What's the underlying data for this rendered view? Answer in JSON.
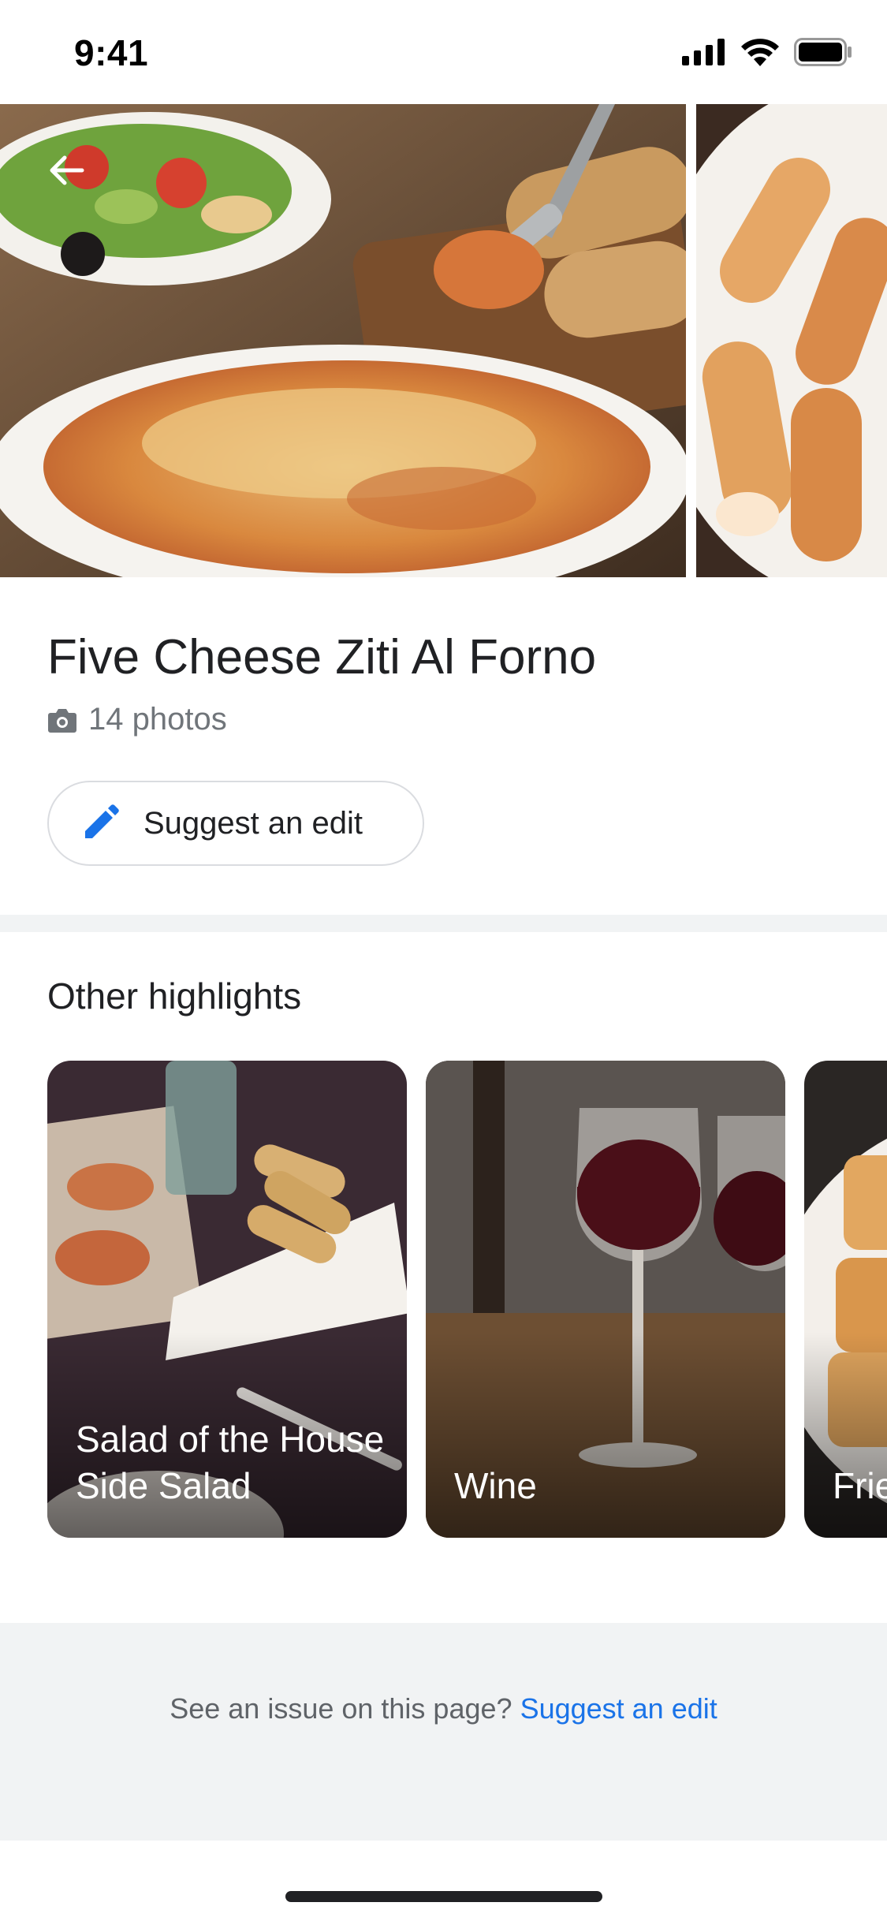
{
  "status_bar": {
    "time": "9:41"
  },
  "dish": {
    "title": "Five Cheese Ziti Al Forno",
    "photo_count": "14 photos",
    "suggest_edit_label": "Suggest an edit"
  },
  "highlights": {
    "heading": "Other highlights",
    "items": [
      {
        "label": "Salad of the House Side Salad"
      },
      {
        "label": "Wine"
      },
      {
        "label": "Frie"
      }
    ]
  },
  "footer": {
    "prompt": "See an issue on this page?",
    "link": "Suggest an edit"
  },
  "icons": {
    "back": "back-arrow-icon",
    "camera": "camera-icon",
    "edit": "pencil-icon"
  },
  "colors": {
    "accent": "#1a73e8",
    "text_primary": "#202124",
    "text_secondary": "#70757a",
    "footer_bg": "#f1f3f4"
  }
}
